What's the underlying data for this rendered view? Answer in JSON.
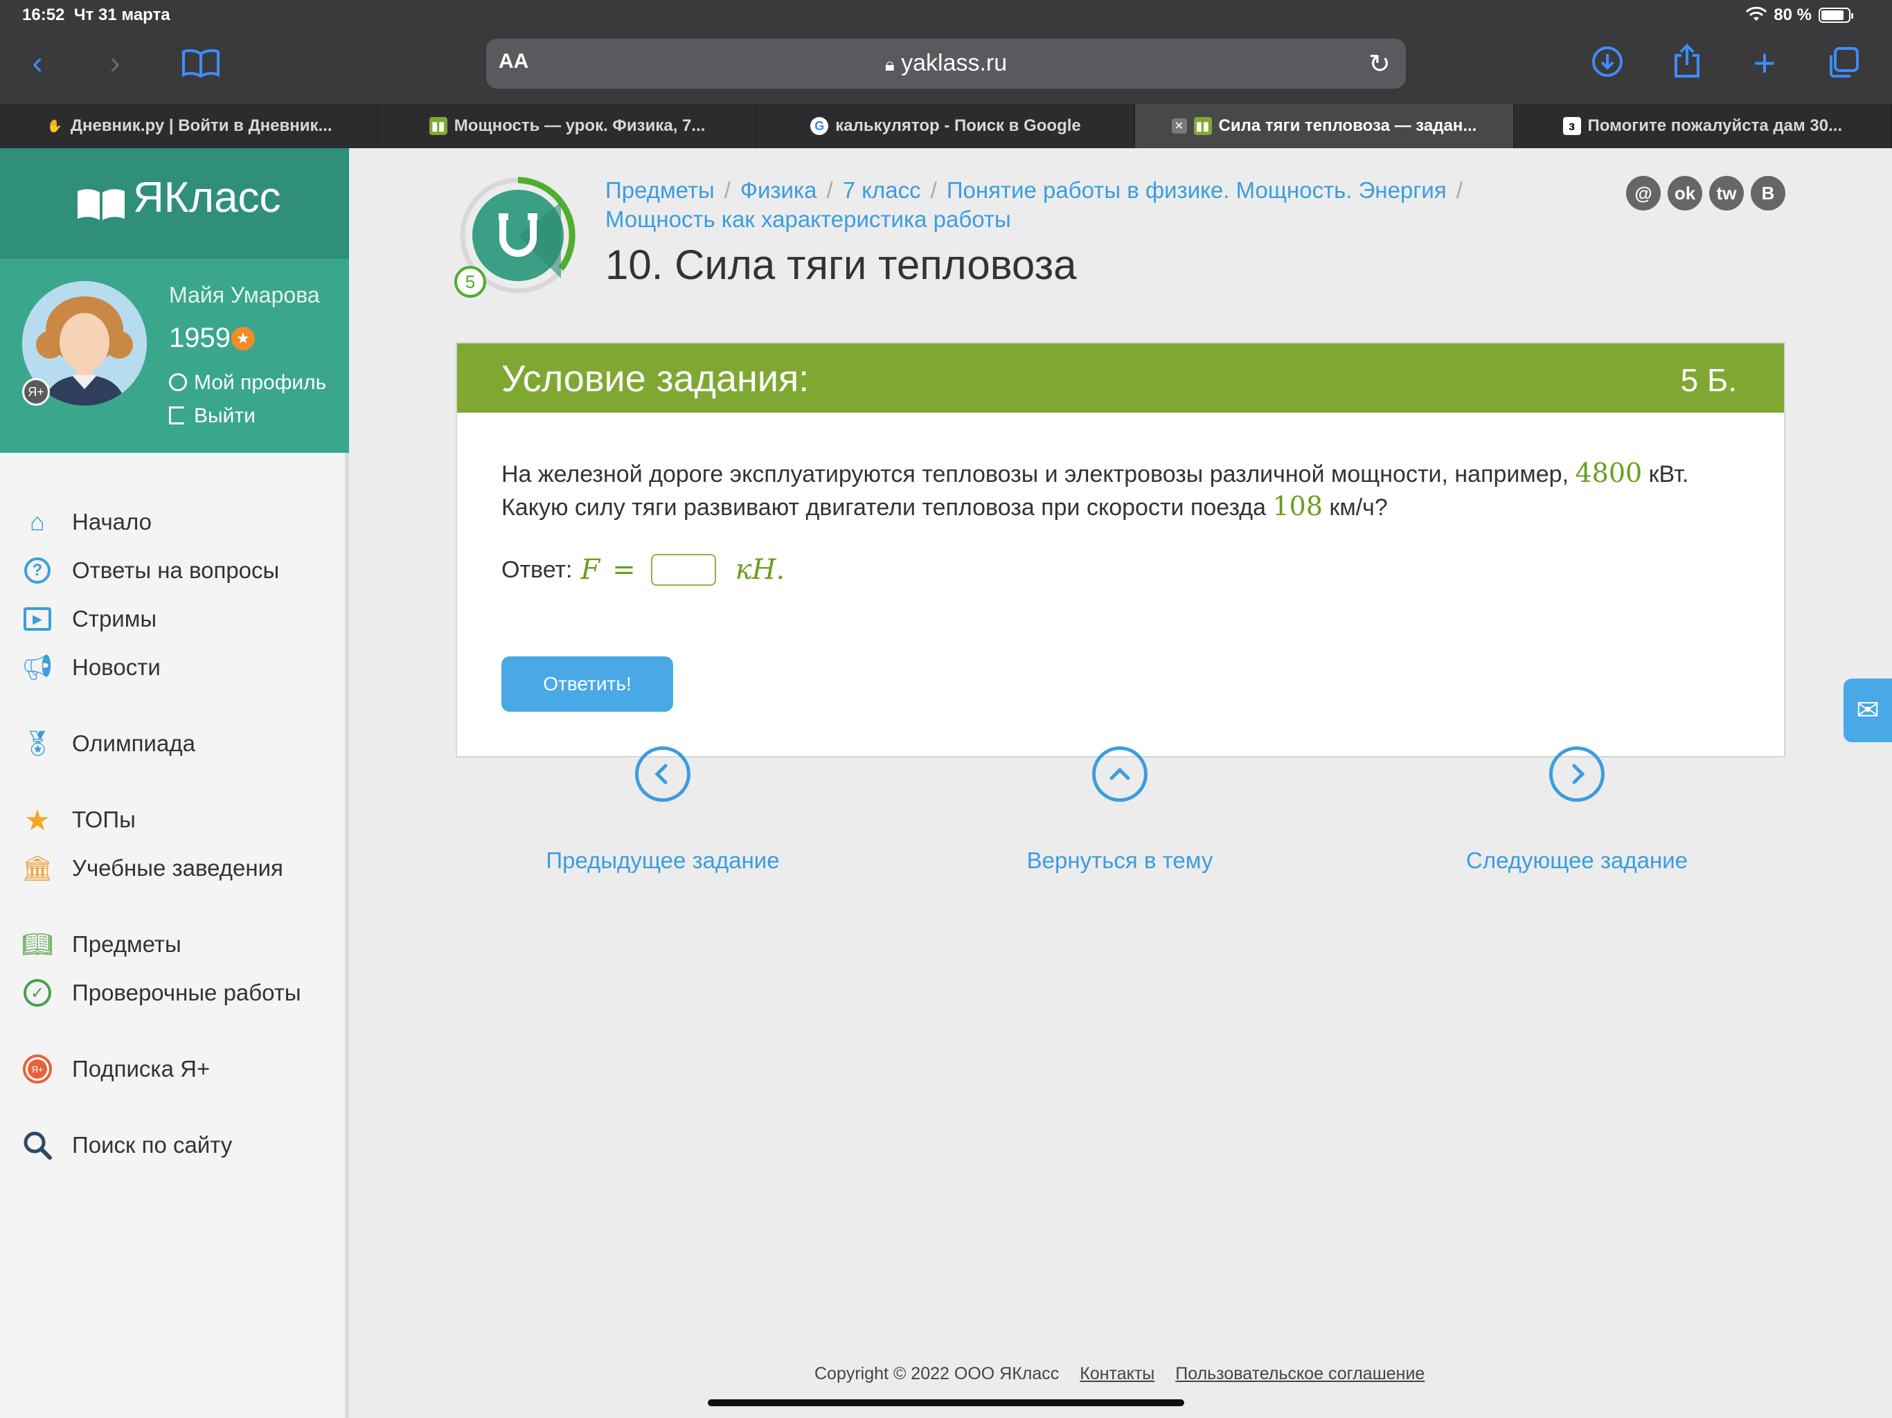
{
  "status_bar": {
    "time": "16:52",
    "date": "Чт 31 марта",
    "battery": "80 %",
    "battery_level": 0.8
  },
  "browser": {
    "aa_label": "AA",
    "url": "yaklass.ru",
    "icons": [
      "back-icon",
      "forward-icon",
      "bookmarks-icon",
      "lock-icon",
      "reload-icon",
      "download-icon",
      "share-icon",
      "new-tab-icon",
      "tabs-overview-icon"
    ],
    "tabs": [
      {
        "title": "Дневник.ру | Войти в Дневник...",
        "icon": "hand-icon",
        "active": false
      },
      {
        "title": "Мощность — урок. Физика, 7...",
        "icon": "yaklass-book-icon",
        "active": false
      },
      {
        "title": "калькулятор - Поиск в Google",
        "icon": "google-icon",
        "active": false
      },
      {
        "title": "Сила тяги тепловоза — задан...",
        "icon": "yaklass-book-icon",
        "active": true
      },
      {
        "title": "Помогите пожалуйста дам 30...",
        "icon": "znanija-icon",
        "active": false
      }
    ]
  },
  "sidebar": {
    "logo": "ЯКласс",
    "user_name": "Майя Умарова",
    "points": "1959",
    "profile_link": "Мой профиль",
    "logout_link": "Выйти",
    "badge": "Я+",
    "menu": [
      {
        "label": "Начало",
        "icon": "home-icon"
      },
      {
        "label": "Ответы на вопросы",
        "icon": "question-icon"
      },
      {
        "label": "Стримы",
        "icon": "play-icon"
      },
      {
        "label": "Новости",
        "icon": "megaphone-icon"
      },
      {
        "label": "Олимпиада",
        "icon": "medal-icon"
      },
      {
        "label": "ТОПы",
        "icon": "star-icon"
      },
      {
        "label": "Учебные заведения",
        "icon": "school-icon"
      },
      {
        "label": "Предметы",
        "icon": "books-icon"
      },
      {
        "label": "Проверочные работы",
        "icon": "check-icon"
      },
      {
        "label": "Подписка Я+",
        "icon": "subscription-icon"
      },
      {
        "label": "Поиск по сайту",
        "icon": "search-icon"
      }
    ]
  },
  "header": {
    "level": "5",
    "breadcrumbs": [
      "Предметы",
      "Физика",
      "7 класс",
      "Понятие работы в физике. Мощность. Энергия",
      "Мощность как характеристика работы"
    ],
    "title": "10. Сила тяги тепловоза",
    "social": [
      {
        "label": "@",
        "icon": "mail-ru-icon"
      },
      {
        "label": "ok",
        "icon": "odnoklassniki-icon"
      },
      {
        "label": "tw",
        "icon": "twitter-icon"
      },
      {
        "label": "В",
        "icon": "vk-icon"
      }
    ]
  },
  "task": {
    "heading": "Условие задания:",
    "points": "5 Б.",
    "text_1": "На железной дороге эксплуатируются тепловозы и электровозы различной мощности, например,",
    "power_value": "4800",
    "power_unit": "кВт.",
    "text_2": "Какую силу тяги развивают двигатели тепловоза при скорости поезда",
    "speed_value": "108",
    "speed_unit": "км/ч?",
    "answer_label": "Ответ:",
    "answer_var": "F",
    "answer_eq": "=",
    "answer_value": "",
    "answer_unit": "кН.",
    "submit": "Ответить!"
  },
  "navigation": {
    "prev": "Предыдущее задание",
    "up": "Вернуться в тему",
    "next": "Следующее задание"
  },
  "footer": {
    "copyright": "Copyright © 2022 ООО ЯКласс",
    "contacts": "Контакты",
    "agreement": "Пользовательское соглашение"
  },
  "colors": {
    "sidebar_logo": "#2f8f7b",
    "sidebar_profile": "#3aa78c",
    "task_header": "#7fa832",
    "link": "#3a9de0",
    "button": "#48a9e6",
    "math": "#6a9e1e"
  }
}
